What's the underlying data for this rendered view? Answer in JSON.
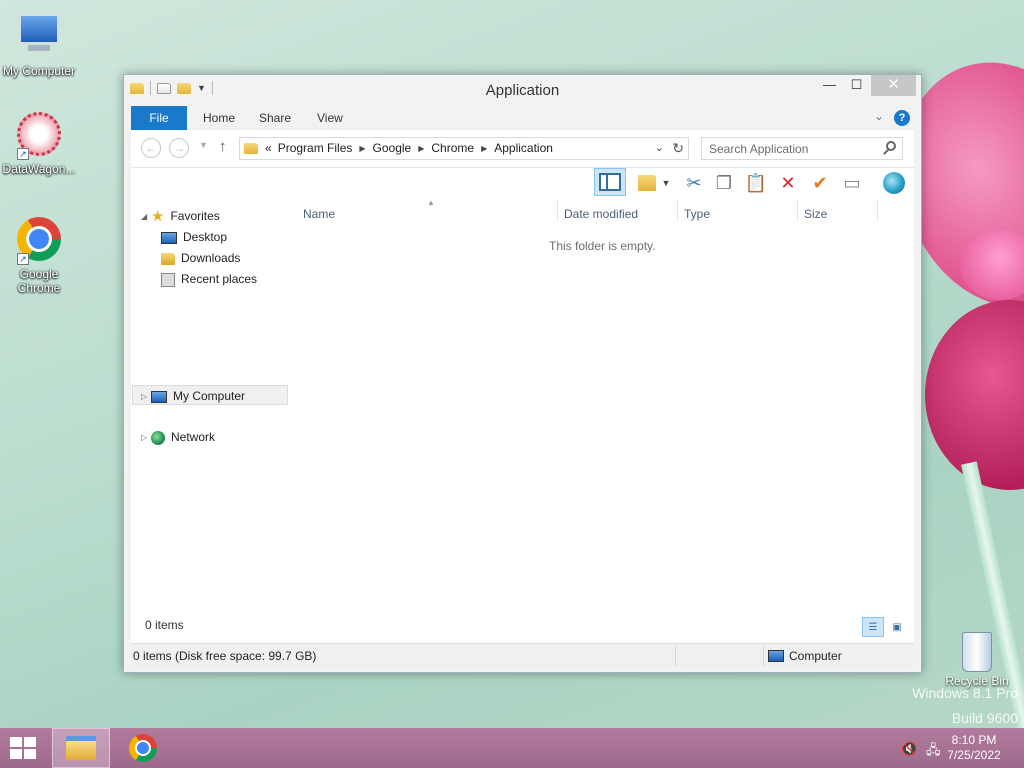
{
  "desktop": {
    "icons": [
      {
        "label": "My Computer",
        "icon": "monitor-icon"
      },
      {
        "label": "DataWagon...",
        "icon": "datawagon-icon"
      },
      {
        "label": "Google Chrome",
        "icon": "chrome-icon"
      },
      {
        "label": "Recycle Bin",
        "icon": "recycle-bin-icon"
      }
    ],
    "watermark_line1": "Windows 8.1 Pro",
    "watermark_line2": "Build 9600"
  },
  "window": {
    "title": "Application",
    "controls": {
      "minimize": "—",
      "maximize": "☐",
      "close": "✕"
    }
  },
  "ribbon": {
    "tabs": [
      {
        "label": "File"
      },
      {
        "label": "Home"
      },
      {
        "label": "Share"
      },
      {
        "label": "View"
      }
    ],
    "help": "?"
  },
  "navigation": {
    "back": "←",
    "forward": "→",
    "up": "↑",
    "breadcrumb_overflow": "«",
    "breadcrumbs": [
      "Program Files",
      "Google",
      "Chrome",
      "Application"
    ],
    "search_placeholder": "Search Application"
  },
  "navpane": {
    "favorites": "Favorites",
    "favorite_items": [
      "Desktop",
      "Downloads",
      "Recent places"
    ],
    "my_computer": "My Computer",
    "network": "Network"
  },
  "filelist": {
    "columns": [
      "Name",
      "Date modified",
      "Type",
      "Size"
    ],
    "empty_message": "This folder is empty.",
    "item_count": "0 items"
  },
  "statusbar": {
    "left": "0 items (Disk free space: 99.7 GB)",
    "right": "Computer"
  },
  "taskbar": {
    "time": "8:10 PM",
    "date": "7/25/2022"
  },
  "colors": {
    "accent": "#1979ca",
    "taskbar": "#a8739a"
  }
}
